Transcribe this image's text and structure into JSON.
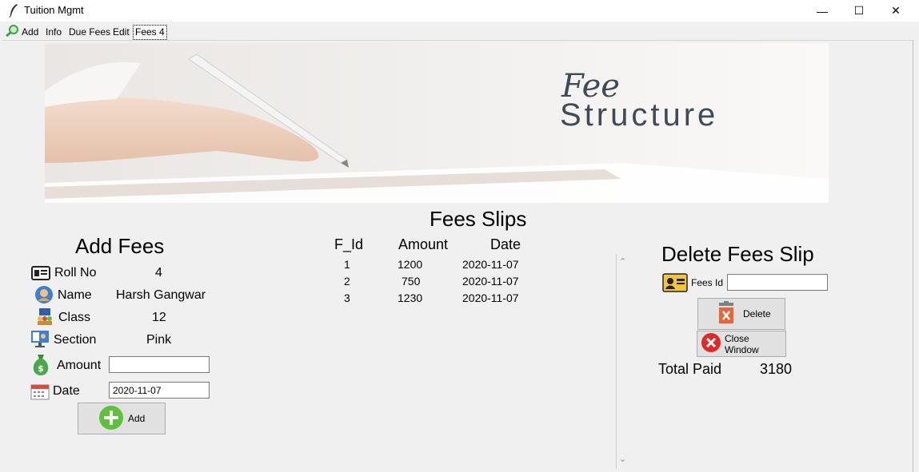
{
  "window": {
    "title": "Tuition Mgmt",
    "minimize_glyph": "—",
    "maximize_glyph": "☐",
    "close_glyph": "✕"
  },
  "tabs": [
    {
      "label": "Add",
      "icon": "search-icon"
    },
    {
      "label": "Info"
    },
    {
      "label": "Due Fees"
    },
    {
      "label": "Edit"
    },
    {
      "label": "Fees 4",
      "active": true
    }
  ],
  "banner": {
    "line1": "Fee",
    "line2": "Structure"
  },
  "slips": {
    "heading": "Fees Slips",
    "columns": [
      "F_Id",
      "Amount",
      "Date"
    ],
    "rows": [
      {
        "id": "1",
        "amount": "1200",
        "date": "2020-11-07"
      },
      {
        "id": "2",
        "amount": "750",
        "date": "2020-11-07"
      },
      {
        "id": "3",
        "amount": "1230",
        "date": "2020-11-07"
      }
    ]
  },
  "add_fees": {
    "heading": "Add Fees",
    "roll_label": "Roll No",
    "roll_value": "4",
    "name_label": "Name",
    "name_value": "Harsh Gangwar",
    "class_label": "Class",
    "class_value": "12",
    "section_label": "Section",
    "section_value": "Pink",
    "amount_label": "Amount",
    "amount_value": "",
    "date_label": "Date",
    "date_value": "2020-11-07",
    "add_button": "Add"
  },
  "delete": {
    "heading": "Delete Fees Slip",
    "fees_id_label": "Fees Id",
    "fees_id_value": "",
    "delete_button": "Delete",
    "close_button": "Close Window",
    "total_label": "Total Paid",
    "total_value": "3180"
  },
  "scroll": {
    "up": "⌃",
    "down": "⌄"
  },
  "colors": {
    "window_bg": "#f0f0f0",
    "button_bg": "#e1e1e1",
    "banner_text": "#3e4a55",
    "add_icon_green": "#5cc23b",
    "delete_icon_red": "#e0483a"
  }
}
